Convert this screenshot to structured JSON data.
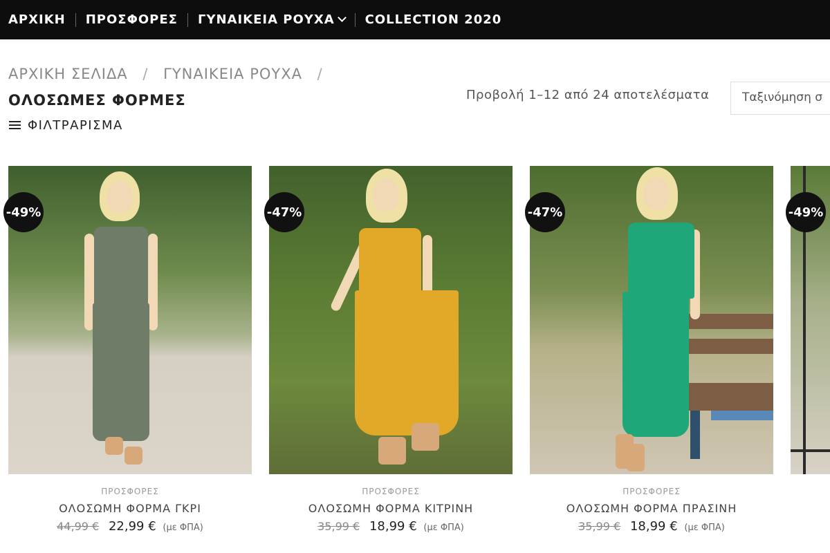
{
  "nav": {
    "items": [
      {
        "label": "ΑΡΧΙΚΗ"
      },
      {
        "label": "ΠΡΟΣΦΟΡΕΣ"
      },
      {
        "label": "ΓΥΝΑΙΚΕΙΑ ΡΟΥΧΑ"
      },
      {
        "label": "COLLECTION 2020"
      }
    ]
  },
  "breadcrumb": {
    "home": "ΑΡΧΙΚΗ ΣΕΛΙΔΑ",
    "category": "ΓΥΝΑΙΚΕΙΑ ΡΟΥΧΑ",
    "current": "ΟΛΟΣΩΜΕΣ ΦΟΡΜΕΣ",
    "separator": "/"
  },
  "results_text": "Προβολή 1–12 από 24 αποτελέσματα",
  "sort": {
    "label": "Ταξινόμηση σ"
  },
  "filter_label": "ΦΙΛΤΡΑΡΙΣΜΑ",
  "vat_label": "(με ΦΠΑ)",
  "products": [
    {
      "badge": "-49%",
      "category": "ΠΡΟΣΦΟΡΕΣ",
      "name": "ΟΛΟΣΩΜΗ ΦΟΡΜΑ ΓΚΡΙ",
      "old_price": "44,99 €",
      "price": "22,99 €",
      "outfit_color": "#6f7d68"
    },
    {
      "badge": "-47%",
      "category": "ΠΡΟΣΦΟΡΕΣ",
      "name": "ΟΛΟΣΩΜΗ ΦΟΡΜΑ ΚΙΤΡΙΝΗ",
      "old_price": "35,99 €",
      "price": "18,99 €",
      "outfit_color": "#e2a928"
    },
    {
      "badge": "-47%",
      "category": "ΠΡΟΣΦΟΡΕΣ",
      "name": "ΟΛΟΣΩΜΗ ΦΟΡΜΑ ΠΡΑΣΙΝΗ",
      "old_price": "35,99 €",
      "price": "18,99 €",
      "outfit_color": "#1fa77a"
    },
    {
      "badge": "-49%"
    }
  ]
}
